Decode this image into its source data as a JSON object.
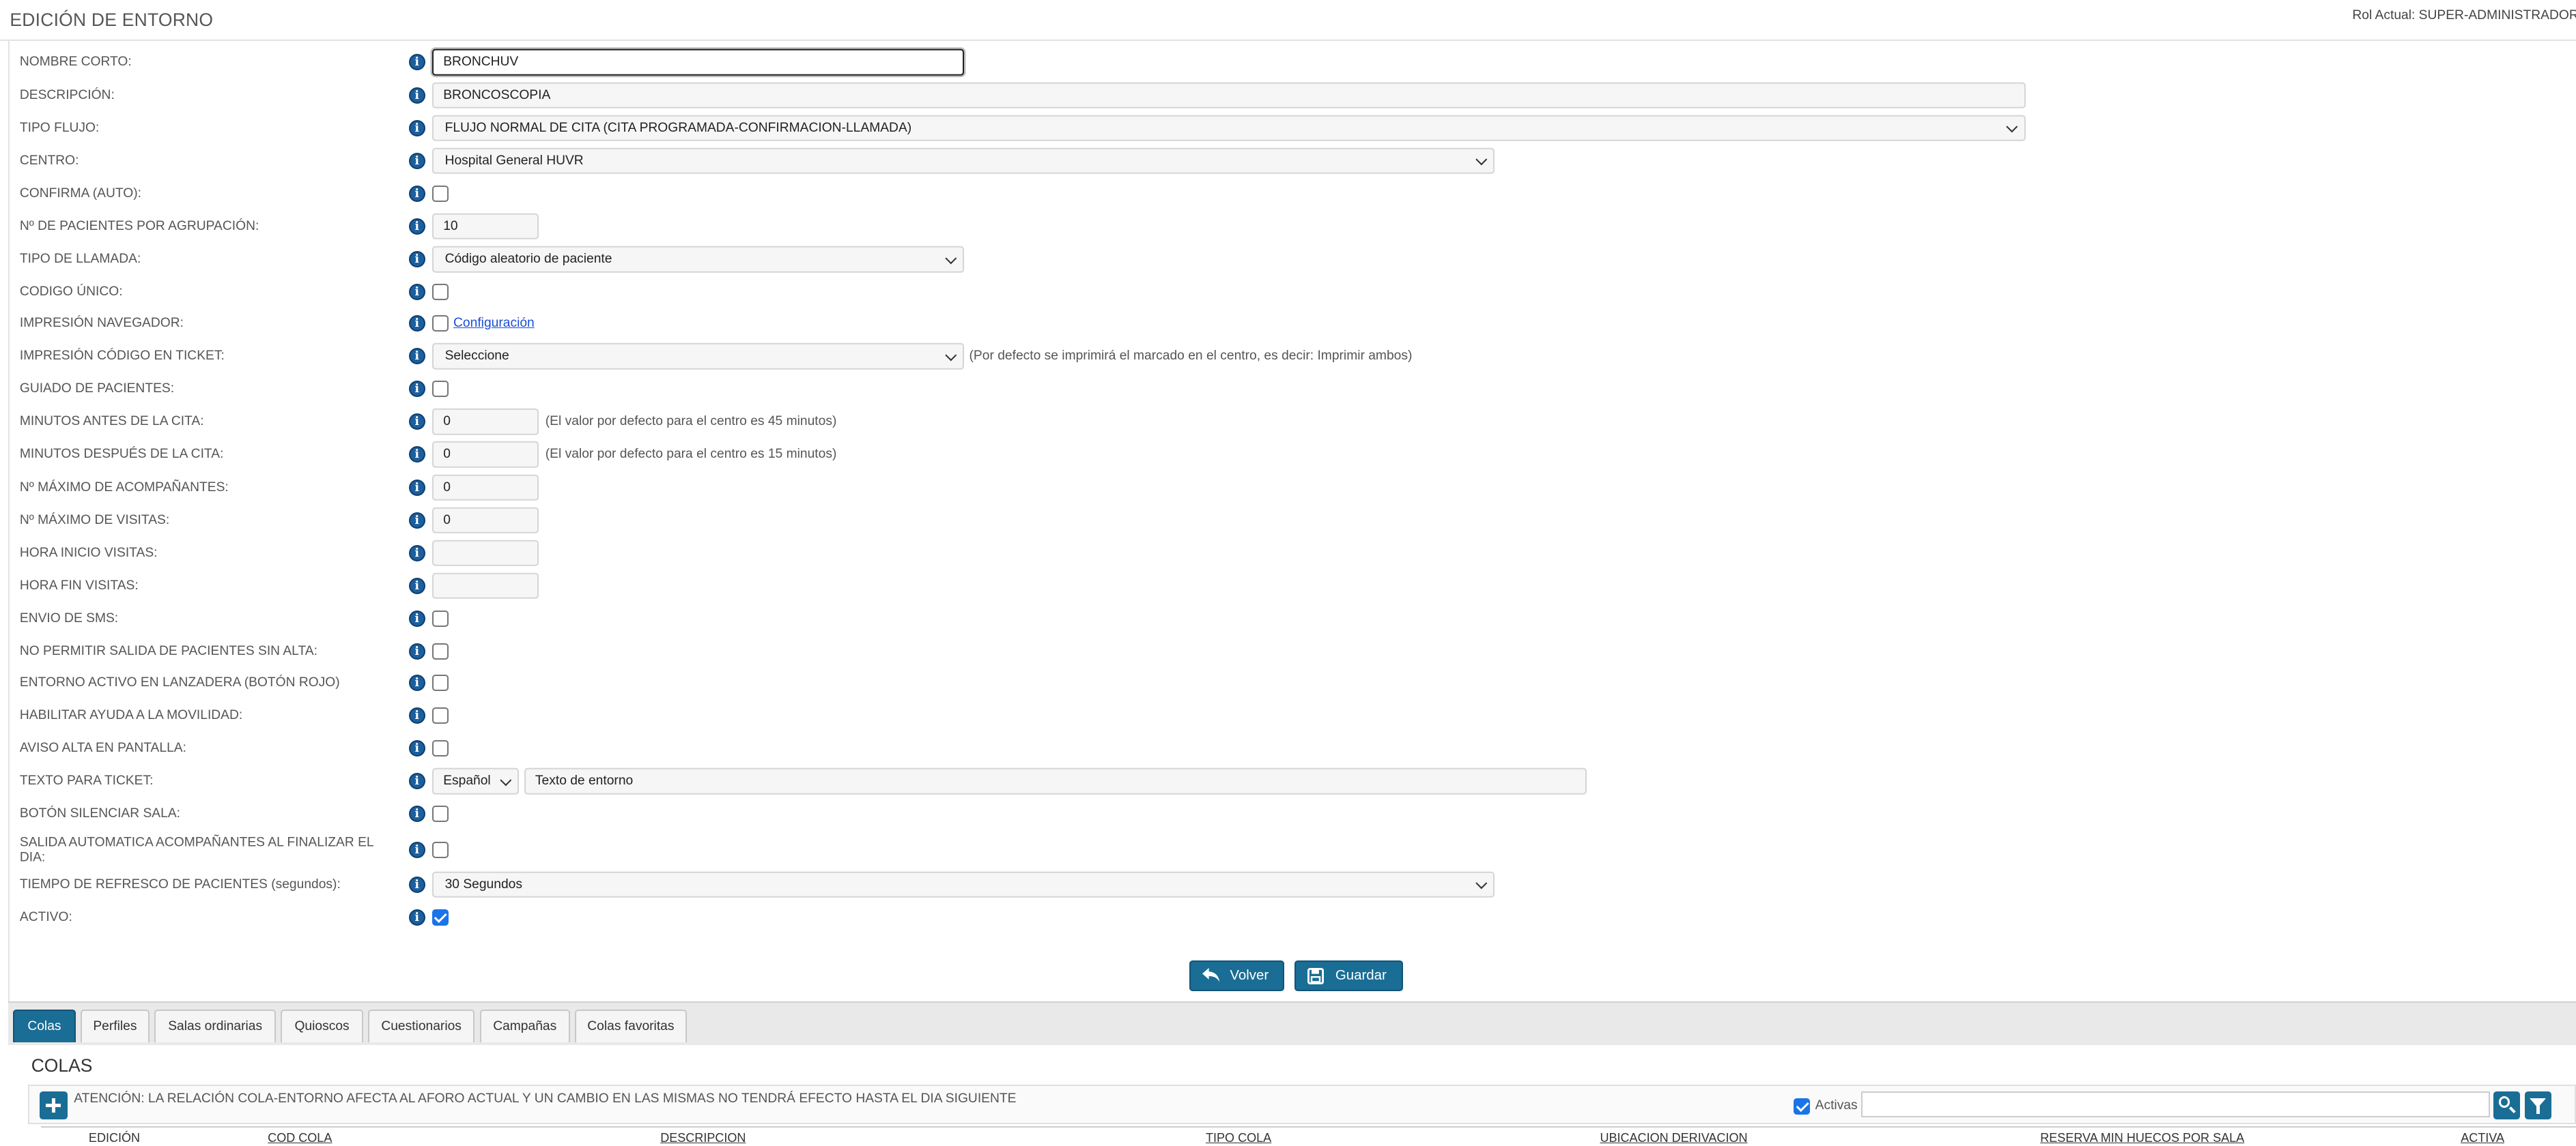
{
  "header": {
    "title": "EDICIÓN DE ENTORNO",
    "role": "Rol Actual: SUPER-ADMINISTRADOR"
  },
  "form": {
    "nombre_corto": {
      "label": "NOMBRE CORTO:",
      "value": "BRONCHUV"
    },
    "descripcion": {
      "label": "DESCRIPCIÓN:",
      "value": "BRONCOSCOPIA"
    },
    "tipo_flujo": {
      "label": "TIPO FLUJO:",
      "value": "FLUJO NORMAL DE CITA (CITA PROGRAMADA-CONFIRMACION-LLAMADA)"
    },
    "centro": {
      "label": "CENTRO:",
      "value": "Hospital General HUVR"
    },
    "confirma_auto": {
      "label": "CONFIRMA (AUTO):",
      "checked": false
    },
    "pacientes_agrupacion": {
      "label": "Nº DE PACIENTES POR AGRUPACIÓN:",
      "value": "10"
    },
    "tipo_llamada": {
      "label": "TIPO DE LLAMADA:",
      "value": "Código aleatorio de paciente"
    },
    "codigo_unico": {
      "label": "CODIGO ÚNICO:",
      "checked": false
    },
    "impresion_navegador": {
      "label": "IMPRESIÓN NAVEGADOR:",
      "checked": false,
      "link": "Configuración"
    },
    "impresion_codigo_ticket": {
      "label": "IMPRESIÓN CÓDIGO EN TICKET:",
      "value": "Seleccione",
      "note": "(Por defecto se imprimirá el marcado en el centro, es decir: Imprimir ambos)"
    },
    "guiado_pacientes": {
      "label": "GUIADO DE PACIENTES:",
      "checked": false
    },
    "minutos_antes": {
      "label": "MINUTOS ANTES DE LA CITA:",
      "value": "0",
      "note": "(El valor por defecto para el centro es 45 minutos)"
    },
    "minutos_despues": {
      "label": "MINUTOS DESPUÉS DE LA CITA:",
      "value": "0",
      "note": "(El valor por defecto para el centro es 15 minutos)"
    },
    "max_acompanantes": {
      "label": "Nº MÁXIMO DE ACOMPAÑANTES:",
      "value": "0"
    },
    "max_visitas": {
      "label": "Nº MÁXIMO DE VISITAS:",
      "value": "0"
    },
    "hora_inicio_visitas": {
      "label": "HORA INICIO VISITAS:",
      "value": ""
    },
    "hora_fin_visitas": {
      "label": "HORA FIN VISITAS:",
      "value": ""
    },
    "envio_sms": {
      "label": "ENVIO DE SMS:",
      "checked": false
    },
    "no_salida_sin_alta": {
      "label": "NO PERMITIR SALIDA DE PACIENTES SIN ALTA:",
      "checked": false
    },
    "entorno_lanzadera": {
      "label": "ENTORNO ACTIVO EN LANZADERA (BOTÓN ROJO)",
      "checked": false
    },
    "ayuda_movilidad": {
      "label": "HABILITAR AYUDA A LA MOVILIDAD:",
      "checked": false
    },
    "aviso_alta": {
      "label": "AVISO ALTA EN PANTALLA:",
      "checked": false
    },
    "texto_ticket": {
      "label": "TEXTO PARA TICKET:",
      "language": "Español",
      "value": "Texto de entorno"
    },
    "silenciar_sala": {
      "label": "BOTÓN SILENCIAR SALA:",
      "checked": false
    },
    "salida_automatica": {
      "label": "SALIDA AUTOMATICA ACOMPAÑANTES AL FINALIZAR EL DIA:",
      "checked": false
    },
    "tiempo_refresco": {
      "label": "TIEMPO DE REFRESCO DE PACIENTES (segundos):",
      "value": "30 Segundos"
    },
    "activo": {
      "label": "ACTIVO:",
      "checked": true
    }
  },
  "actions": {
    "back_label": "Volver",
    "save_label": "Guardar"
  },
  "tabs": [
    "Colas",
    "Perfiles",
    "Salas ordinarias",
    "Quioscos",
    "Cuestionarios",
    "Campañas",
    "Colas favoritas"
  ],
  "active_tab": "Colas",
  "panel": {
    "title": "COLAS",
    "warning": "ATENCIÓN: LA RELACIÓN COLA-ENTORNO AFECTA AL AFORO ACTUAL Y UN CAMBIO EN LAS MISMAS NO TENDRÁ EFECTO HASTA EL DIA SIGUIENTE",
    "activas_label": "Activas",
    "activas_checked": true,
    "search_value": "",
    "columns": [
      "EDICIÓN",
      "COD COLA",
      "DESCRIPCION",
      "TIPO  COLA",
      "UBICACION  DERIVACION",
      "RESERVA MIN HUECOS POR SALA",
      "ACTIVA"
    ]
  },
  "icons": {
    "info": "info-icon",
    "back": "reply-arrow-icon",
    "save": "floppy-disk-icon",
    "add": "plus-icon",
    "search": "search-icon",
    "filter": "filter-icon"
  },
  "colors": {
    "primary": "#1a6d95",
    "info": "#1d5f9c",
    "checkbox": "#1a73e8",
    "link": "#1a4fd6"
  }
}
